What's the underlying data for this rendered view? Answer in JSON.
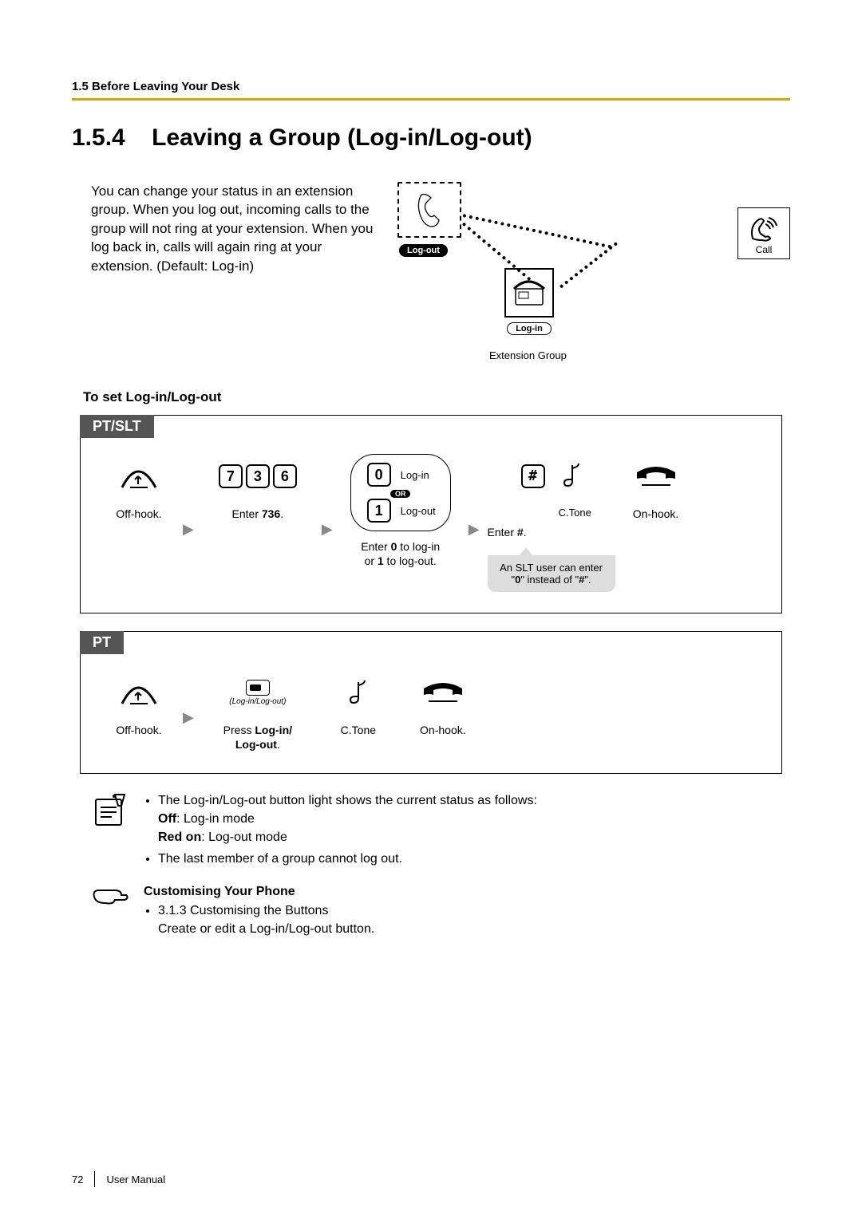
{
  "header": {
    "running_head": "1.5 Before Leaving Your Desk"
  },
  "title": {
    "number": "1.5.4",
    "text": "Leaving a Group (Log-in/Log-out)"
  },
  "intro": "You can change your status in an extension group. When you log out, incoming calls to the group will not ring at your extension. When you log back in, calls will again ring at your extension. (Default: Log-in)",
  "diagram": {
    "logout_label": "Log-out",
    "login_label": "Log-in",
    "call_label": "Call",
    "group_label": "Extension Group"
  },
  "subheading": "To set Log-in/Log-out",
  "flow1": {
    "tab": "PT/SLT",
    "step_offhook": "Off-hook.",
    "keys": [
      "7",
      "3",
      "6"
    ],
    "step_enter736_pre": "Enter ",
    "step_enter736_code": "736",
    "step_enter736_post": ".",
    "opt0_key": "0",
    "opt0_label": "Log-in",
    "or_label": "OR",
    "opt1_key": "1",
    "opt1_label": "Log-out",
    "step_enter01_a": "Enter ",
    "step_enter01_b": "0",
    "step_enter01_c": " to log-in",
    "step_enter01_d": "or ",
    "step_enter01_e": "1",
    "step_enter01_f": " to log-out.",
    "hash_key": "#",
    "ctone_label": "C.Tone",
    "step_enterhash_a": "Enter ",
    "step_enterhash_b": "#",
    "step_enterhash_c": ".",
    "slt_note_a": "An SLT user can enter \"",
    "slt_note_b": "0",
    "slt_note_c": "\" instead of \"",
    "slt_note_d": "#",
    "slt_note_e": "\".",
    "step_onhook": "On-hook."
  },
  "flow2": {
    "tab": "PT",
    "step_offhook": "Off-hook.",
    "btn_small_label": "(Log-in/Log-out)",
    "step_press_a": "Press ",
    "step_press_b": "Log-in/",
    "step_press_c": "Log-out",
    "step_press_d": ".",
    "ctone_label": "C.Tone",
    "step_onhook": "On-hook."
  },
  "notes": {
    "line1": "The Log-in/Log-out button light shows the current status as follows:",
    "off_label": "Off",
    "off_text": ": Log-in mode",
    "red_label": "Red on",
    "red_text": ": Log-out mode",
    "line3": "The last member of a group cannot log out."
  },
  "customise": {
    "heading": "Customising Your Phone",
    "ref": "3.1.3 Customising the Buttons",
    "desc": "Create or edit a Log-in/Log-out button."
  },
  "footer": {
    "page": "72",
    "label": "User Manual"
  }
}
